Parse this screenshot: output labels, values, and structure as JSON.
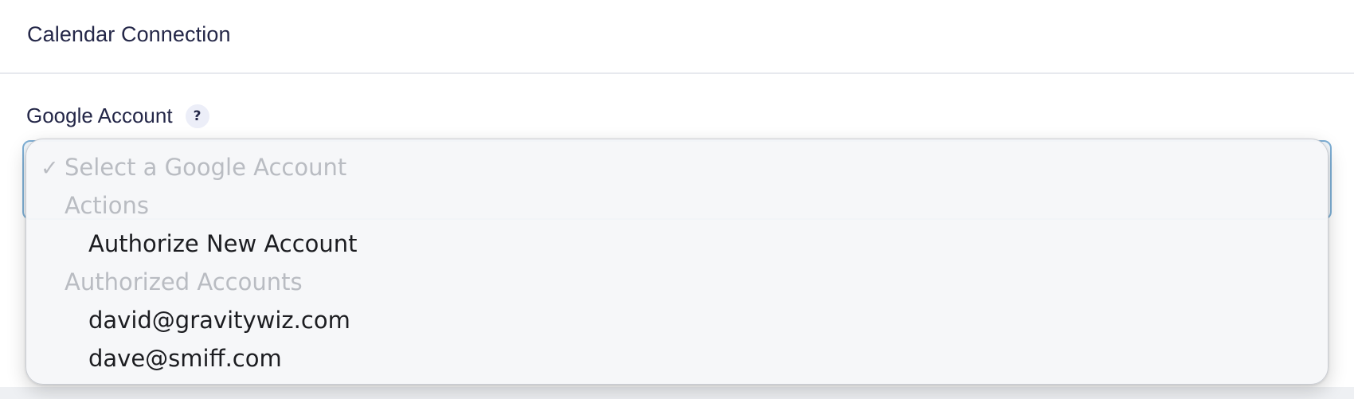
{
  "header": {
    "title": "Calendar Connection"
  },
  "field": {
    "label": "Google Account",
    "help_glyph": "?",
    "help_icon": "help-icon"
  },
  "dropdown": {
    "check_glyph": "✓",
    "selected_placeholder": "Select a Google Account",
    "groups": [
      {
        "label": "Actions",
        "options": [
          "Authorize New Account"
        ]
      },
      {
        "label": "Authorized Accounts",
        "options": [
          "david@gravitywiz.com",
          "dave@smiff.com"
        ]
      }
    ]
  },
  "colors": {
    "heading_text": "#242748",
    "disabled_option": "#b9bcc2",
    "select_border": "#7fb0d6"
  }
}
